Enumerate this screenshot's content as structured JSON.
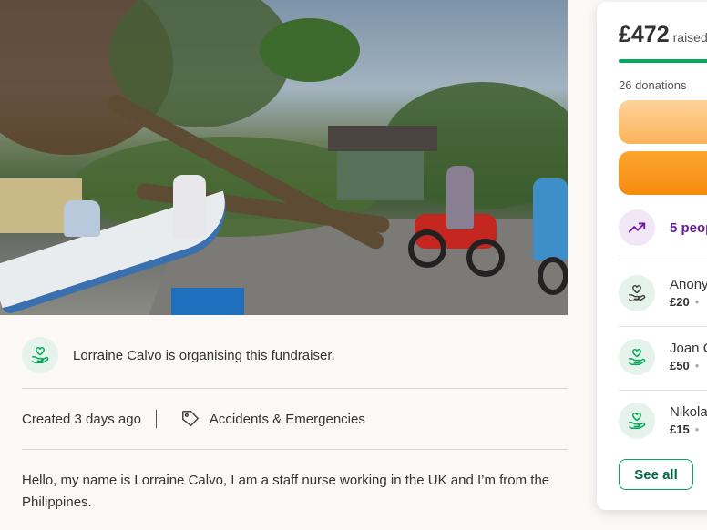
{
  "organiser": {
    "text": "Lorraine Calvo is organising this fundraiser."
  },
  "meta": {
    "created": "Created 3 days ago",
    "category": "Accidents & Emergencies"
  },
  "story": {
    "text": "Hello, my name is Lorraine Calvo, I am a staff nurse working in the UK and I’m from the Philippines."
  },
  "card": {
    "amount": "£472",
    "raised_label": "raised",
    "progress_fraction": 0.9,
    "donations": "26 donations",
    "trend_text": "5 peop",
    "donors": [
      {
        "name": "Anony",
        "amount": "£20"
      },
      {
        "name": "Joan C",
        "amount": "£50"
      },
      {
        "name": "Nikola",
        "amount": "£15"
      }
    ],
    "see_all": "See all"
  },
  "colors": {
    "accent_green": "#02a95c",
    "donate_orange": "#f78a0f",
    "trend_purple": "#6b1b9e"
  },
  "icons": {
    "organiser": "heart-hand-icon",
    "category": "tag-icon",
    "trend": "trending-up-icon",
    "donor": "heart-hand-icon"
  }
}
